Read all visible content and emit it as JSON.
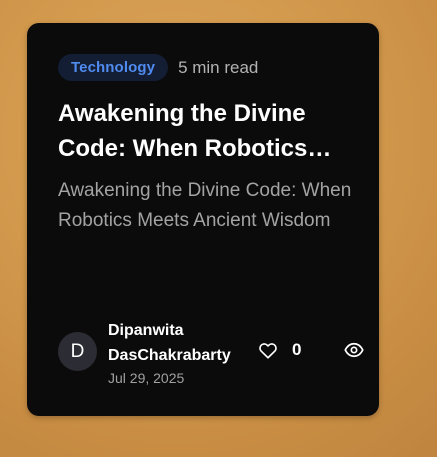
{
  "card": {
    "category": "Technology",
    "read_time": "5 min read",
    "title": "Awakening the Divine Code: When Robotics Meets Ancient Wisdom",
    "excerpt": "Awakening the Divine Code: When Robotics Meets Ancient Wisdom",
    "author": {
      "initial": "D",
      "name": "Dipanwita DasChakrabarty",
      "date": "Jul 29, 2025"
    },
    "likes": "0",
    "icons": {
      "like": "heart-icon",
      "views": "eye-icon"
    }
  },
  "colors": {
    "background": "#d39a4e",
    "card": "#0b0b0c",
    "category_text": "#4f8bf0",
    "category_bg": "#131d33"
  }
}
